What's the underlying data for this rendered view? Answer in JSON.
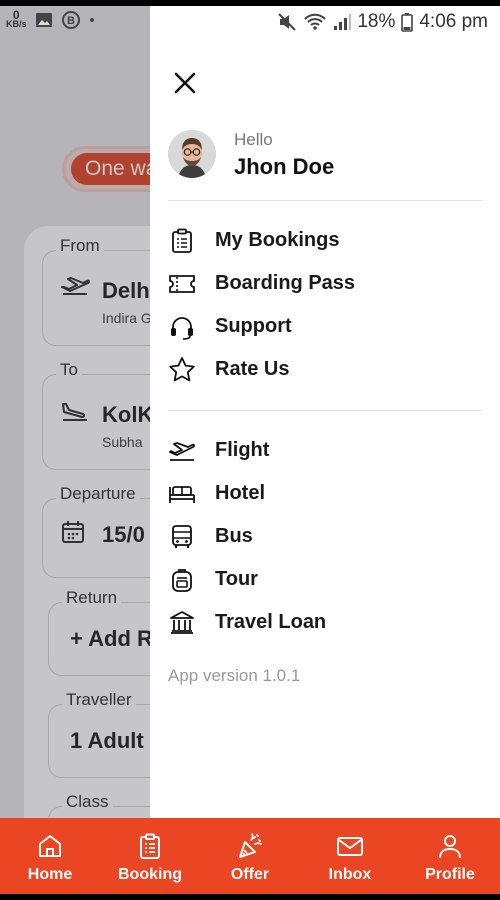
{
  "status_bar": {
    "net_speed_value": "0",
    "net_speed_unit": "KB/s",
    "battery": "18%",
    "time": "4:06 pm"
  },
  "background": {
    "trip_type": "One wa",
    "fields": [
      {
        "label": "From",
        "value": "Delh",
        "sub": "Indira G"
      },
      {
        "label": "To",
        "value": "KolK",
        "sub": "Subha"
      },
      {
        "label": "Departure",
        "value": "15/0",
        "sub": ""
      },
      {
        "label": "Return",
        "value": "+ Add R",
        "sub": ""
      },
      {
        "label": "Traveller",
        "value": "1 Adult",
        "sub": ""
      },
      {
        "label": "Class",
        "value": "",
        "sub": ""
      }
    ]
  },
  "drawer": {
    "greeting": "Hello",
    "user_name": "Jhon Doe",
    "menu_primary": [
      {
        "label": "My Bookings",
        "icon": "clipboard-icon"
      },
      {
        "label": "Boarding Pass",
        "icon": "ticket-icon"
      },
      {
        "label": "Support",
        "icon": "headset-icon"
      },
      {
        "label": "Rate Us",
        "icon": "star-icon"
      }
    ],
    "menu_services": [
      {
        "label": "Flight",
        "icon": "plane-icon"
      },
      {
        "label": "Hotel",
        "icon": "bed-icon"
      },
      {
        "label": "Bus",
        "icon": "bus-icon"
      },
      {
        "label": "Tour",
        "icon": "backpack-icon"
      },
      {
        "label": "Travel Loan",
        "icon": "bank-icon"
      }
    ],
    "app_version": "App version 1.0.1"
  },
  "bottom_nav": [
    {
      "label": "Home",
      "icon": "home-icon"
    },
    {
      "label": "Booking",
      "icon": "clipboard-icon"
    },
    {
      "label": "Offer",
      "icon": "party-popper-icon"
    },
    {
      "label": "Inbox",
      "icon": "mail-icon"
    },
    {
      "label": "Profile",
      "icon": "user-icon"
    }
  ],
  "colors": {
    "accent": "#ea4624",
    "drawer_bg": "#ffffff",
    "text": "#1a1a1a"
  }
}
